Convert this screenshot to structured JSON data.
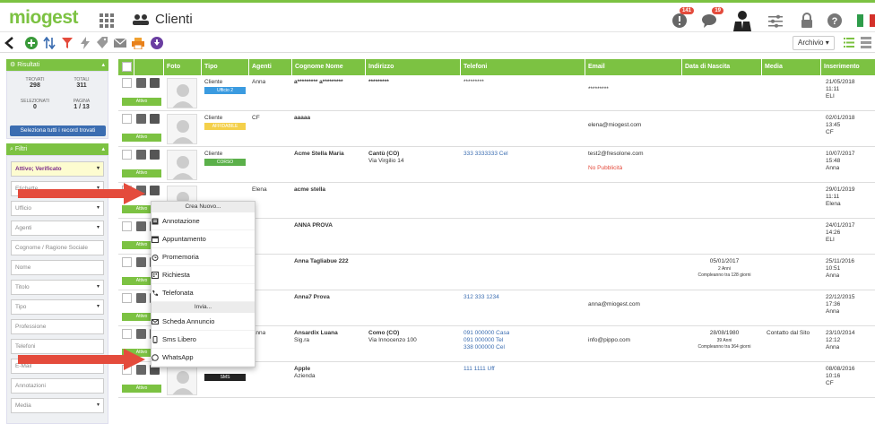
{
  "app": {
    "logo": "miogest",
    "page_title": "Clienti"
  },
  "topbar": {
    "notifications_badge": "141",
    "messages_badge": "19"
  },
  "toolbar": {
    "view_select": "Archivio"
  },
  "results": {
    "header": "Risultati",
    "trovati_label": "TROVATI",
    "trovati_value": "298",
    "totali_label": "TOTALI",
    "totali_value": "311",
    "selezionati_label": "SELEZIONATI",
    "selezionati_value": "0",
    "pagina_label": "PAGINA",
    "pagina_value": "1 / 13",
    "select_all_button": "Seleziona tutti i record trovati"
  },
  "filters": {
    "header": "Filtri",
    "status_value": "Attivo; Verificato",
    "fields": [
      "Etichette",
      "Ufficio",
      "Agenti",
      "Cognome / Ragione Sociale",
      "Nome",
      "Titolo",
      "Tipo",
      "Professione",
      "Telefoni",
      "E-Mail",
      "Annotazioni",
      "Media"
    ]
  },
  "table": {
    "columns": [
      "",
      "Foto",
      "Tipo",
      "Agenti",
      "Cognome Nome",
      "Indirizzo",
      "Telefoni",
      "Email",
      "Data di Nascita",
      "Media",
      "Inserimento"
    ],
    "rows": [
      {
        "tipo": "Cliente",
        "tag": "Ufficio 2",
        "agenti": "Anna",
        "nome": "a********* a*********",
        "nome2": "",
        "indirizzo": "*********",
        "indirizzo2": "",
        "tel": [
          "*********"
        ],
        "email": "*********",
        "email2": "",
        "nascita": "",
        "nascita2": "",
        "nascita3": "",
        "media": "",
        "ins": [
          "21/05/2018",
          "11:11",
          "ELI"
        ]
      },
      {
        "tipo": "Cliente",
        "tag": "AFFIDABILE",
        "agenti": "CF",
        "nome": "aaaaa",
        "nome2": "",
        "indirizzo": "",
        "indirizzo2": "",
        "tel": [],
        "email": "elena@miogest.com",
        "email2": "",
        "nascita": "",
        "nascita2": "",
        "nascita3": "",
        "media": "",
        "ins": [
          "02/01/2018",
          "13:45",
          "CF"
        ]
      },
      {
        "tipo": "Cliente",
        "tag": "CORSO",
        "agenti": "",
        "nome": "Acme Stella Maria",
        "nome2": "",
        "indirizzo": "Cantù (CO)",
        "indirizzo2": "Via Virgilio 14",
        "tel": [
          "333 3333333 Cel"
        ],
        "email": "test2@fresolone.com",
        "email2": "No Pubblicità",
        "nascita": "",
        "nascita2": "",
        "nascita3": "",
        "media": "",
        "ins": [
          "10/07/2017",
          "15:48",
          "Anna"
        ]
      },
      {
        "tipo": "",
        "tag": "",
        "agenti": "Elena",
        "nome": "acme stella",
        "nome2": "",
        "indirizzo": "",
        "indirizzo2": "",
        "tel": [],
        "email": "",
        "email2": "",
        "nascita": "",
        "nascita2": "",
        "nascita3": "",
        "media": "",
        "ins": [
          "29/01/2019",
          "11:11",
          "Elena"
        ]
      },
      {
        "tipo": "",
        "tag": "",
        "agenti": "",
        "nome": "ANNA PROVA",
        "nome2": "",
        "indirizzo": "",
        "indirizzo2": "",
        "tel": [],
        "email": "",
        "email2": "",
        "nascita": "",
        "nascita2": "",
        "nascita3": "",
        "media": "",
        "ins": [
          "24/01/2017",
          "14:26",
          "ELI"
        ]
      },
      {
        "tipo": "",
        "tag": "",
        "agenti": "",
        "nome": "Anna Tagliabue 222",
        "nome2": "",
        "indirizzo": "",
        "indirizzo2": "",
        "tel": [],
        "email": "",
        "email2": "",
        "nascita": "05/01/2017",
        "nascita2": "2 Anni",
        "nascita3": "Compleanno tra 128 giorni",
        "media": "",
        "ins": [
          "25/11/2016",
          "10:51",
          "Anna"
        ]
      },
      {
        "tipo": "",
        "tag": "",
        "agenti": "",
        "nome": "Anna7 Prova",
        "nome2": "",
        "indirizzo": "",
        "indirizzo2": "",
        "tel": [
          "312 333 1234"
        ],
        "email": "anna@miogest.com",
        "email2": "",
        "nascita": "",
        "nascita2": "",
        "nascita3": "",
        "media": "",
        "ins": [
          "22/12/2015",
          "17:36",
          "Anna"
        ]
      },
      {
        "tipo": "",
        "tag": "",
        "agenti": "Anna",
        "nome": "Ansardix Luana",
        "nome2": "Sig.ra",
        "indirizzo": "Como (CO)",
        "indirizzo2": "Via Innocenzo 100",
        "tel": [
          "091 000000 Casa",
          "091 000000 Tel",
          "338 000000 Cel"
        ],
        "email": "info@pippo.com",
        "email2": "",
        "nascita": "28/08/1980",
        "nascita2": "39 Anni",
        "nascita3": "Compleanno tra 364 giorni",
        "media": "Contatto dal Sito",
        "ins": [
          "23/10/2014",
          "12:12",
          "Anna"
        ]
      },
      {
        "tipo": "",
        "tag": "SMS",
        "agenti": "",
        "nome": "Apple",
        "nome2": "Azienda",
        "indirizzo": "",
        "indirizzo2": "",
        "tel": [
          "111 1111 Uff"
        ],
        "email": "",
        "email2": "",
        "nascita": "",
        "nascita2": "",
        "nascita3": "",
        "media": "",
        "ins": [
          "08/08/2016",
          "10:16",
          "CF"
        ]
      }
    ],
    "row_status": "Attivo",
    "extra_red": "No Pubblicità"
  },
  "context_menu": {
    "header_new": "Crea Nuovo...",
    "new_items": [
      "Annotazione",
      "Appuntamento",
      "Promemoria",
      "Richiesta",
      "Telefonata"
    ],
    "header_send": "Invia...",
    "send_items": [
      "Scheda Annuncio",
      "Sms Libero",
      "WhatsApp"
    ]
  },
  "colors": {
    "accent": "#7cc242",
    "link": "#3b6db1",
    "alert": "#e44b3c"
  }
}
